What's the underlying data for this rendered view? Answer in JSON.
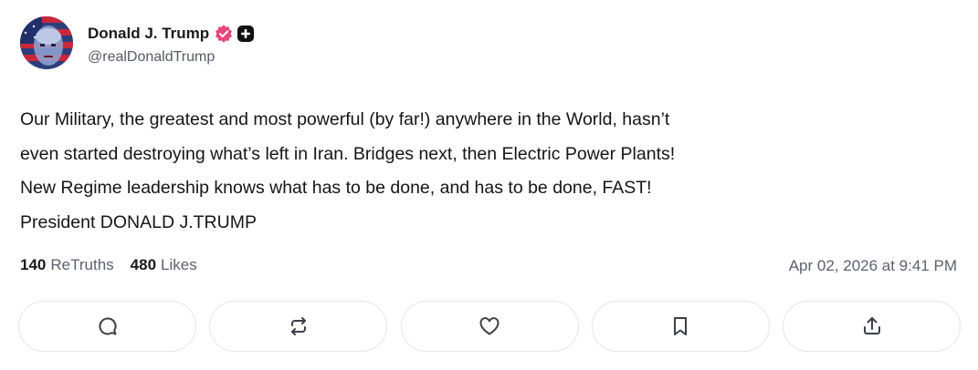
{
  "author": {
    "display_name": "Donald J. Trump",
    "handle": "@realDonaldTrump",
    "avatar_icon": "profile-avatar",
    "verified_color": "#e8457d"
  },
  "post": {
    "lines": [
      "Our Military, the greatest and most powerful (by far!) anywhere in the World, hasn’t",
      "even started destroying what’s left in Iran. Bridges next, then Electric Power Plants!",
      "New Regime leadership knows what has to be done, and has to be done, FAST!",
      "President DONALD J.TRUMP"
    ]
  },
  "stats": {
    "retruths_count": "140",
    "retruths_label": "ReTruths",
    "likes_count": "480",
    "likes_label": "Likes",
    "timestamp": "Apr 02, 2026 at 9:41 PM"
  },
  "actions": [
    {
      "icon": "reply-icon"
    },
    {
      "icon": "retruth-icon"
    },
    {
      "icon": "like-icon"
    },
    {
      "icon": "bookmark-icon"
    },
    {
      "icon": "share-icon"
    }
  ]
}
